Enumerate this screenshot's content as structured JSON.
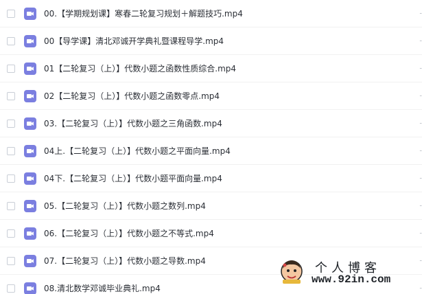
{
  "files": [
    {
      "name": "00.【学期规划课】寒春二轮复习规划＋解题技巧.mp4",
      "icon": "video-file-icon"
    },
    {
      "name": "00【导学课】清北邓诚开学典礼暨课程导学.mp4",
      "icon": "video-file-icon"
    },
    {
      "name": "01【二轮复习（上）】代数小题之函数性质综合.mp4",
      "icon": "video-file-icon"
    },
    {
      "name": "02【二轮复习（上）】代数小题之函数零点.mp4",
      "icon": "video-file-icon"
    },
    {
      "name": "03.【二轮复习（上）】代数小题之三角函数.mp4",
      "icon": "video-file-icon"
    },
    {
      "name": "04上.【二轮复习（上）】代数小题之平面向量.mp4",
      "icon": "video-file-icon"
    },
    {
      "name": "04下.【二轮复习（上）】代数小题平面向量.mp4",
      "icon": "video-file-icon"
    },
    {
      "name": "05.【二轮复习（上）】代数小题之数列.mp4",
      "icon": "video-file-icon"
    },
    {
      "name": "06.【二轮复习（上）】代数小题之不等式.mp4",
      "icon": "video-file-icon"
    },
    {
      "name": "07.【二轮复习（上）】代数小题之导数.mp4",
      "icon": "video-file-icon"
    },
    {
      "name": "08.清北数学邓诚毕业典礼.mp4",
      "icon": "video-file-icon"
    }
  ],
  "watermark": {
    "title": "个人博客",
    "url": "www.92in.com"
  },
  "colors": {
    "icon_purple": "#7B7FE0",
    "text": "#2b2f36",
    "checkbox_border": "#c9ced6"
  }
}
